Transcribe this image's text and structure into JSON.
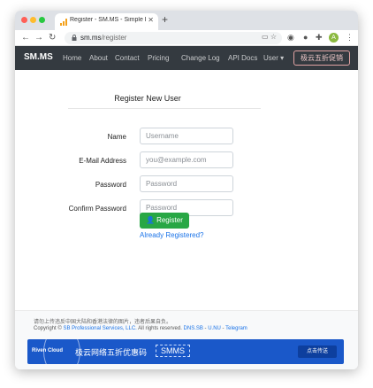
{
  "browser": {
    "tab_title": "Register - SM.MS - Simple Fre",
    "new_tab": "+",
    "url_host": "sm.ms",
    "url_path": "/register",
    "profile_initial": "A"
  },
  "navbar": {
    "brand": "SM.MS",
    "links": [
      "Home",
      "About",
      "Contact",
      "Pricing",
      "Change Log",
      "API Docs",
      "User ▾"
    ],
    "promo": "极云五折促销"
  },
  "form": {
    "title": "Register New User",
    "fields": [
      {
        "label": "Name",
        "placeholder": "Username"
      },
      {
        "label": "E-Mail Address",
        "placeholder": "you@example.com"
      },
      {
        "label": "Password",
        "placeholder": "Password"
      },
      {
        "label": "Confirm Password",
        "placeholder": "Password"
      }
    ],
    "submit": "Register",
    "login_link": "Already Registered?"
  },
  "footer": {
    "notice": "请勿上传违反中国大陆和香港法律的图片，违者后果自负。",
    "copyright_prefix": "Copyright ©",
    "company": "SB Professional Services, LLC.",
    "rights": "All rights reserved.",
    "links": [
      "DNS.SB",
      "U.NU",
      "Telegram"
    ],
    "separator": " - "
  },
  "banner": {
    "brand": "Riven Cloud",
    "text": "极云网络五折优惠码",
    "code": "SMMS",
    "cta": "点击传送"
  },
  "colors": {
    "navbar": "#343a40",
    "register": "#28a745",
    "link": "#1a73e8",
    "banner": "#1a58c9"
  }
}
